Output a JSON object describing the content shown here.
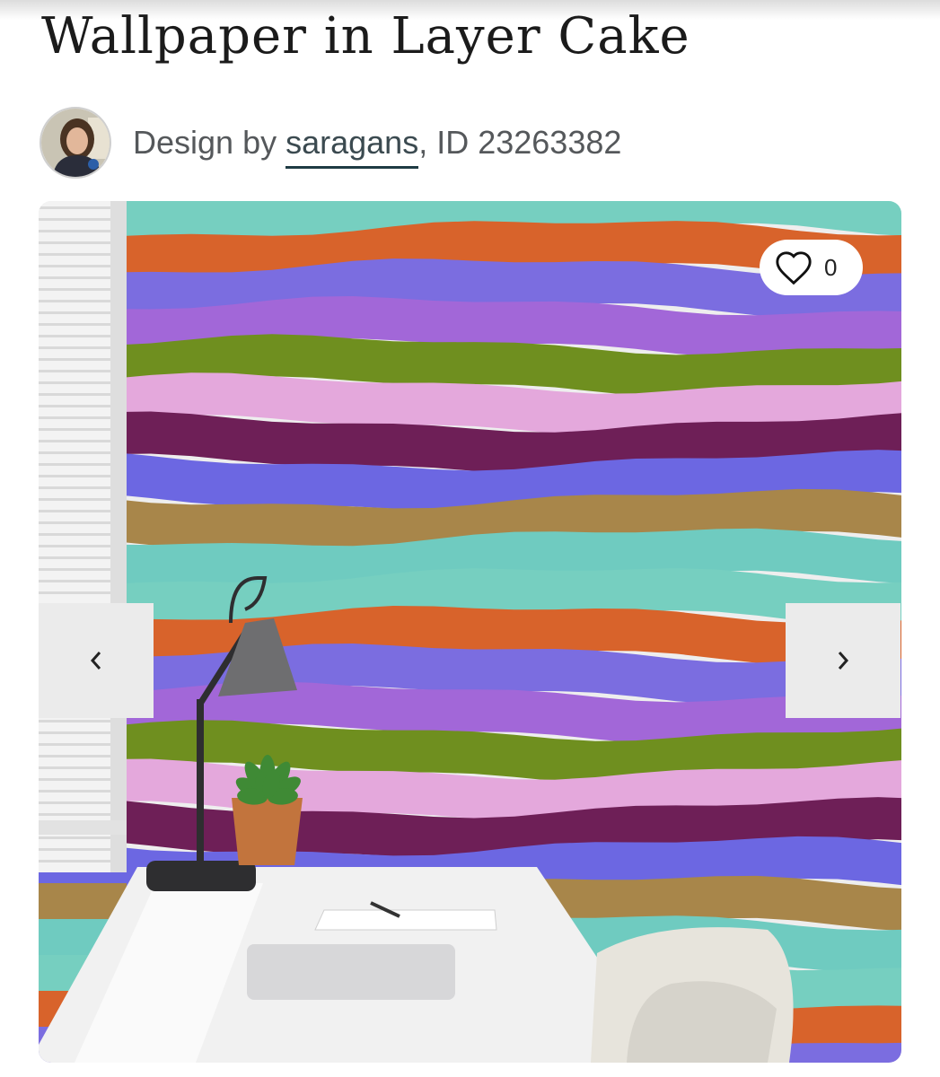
{
  "product": {
    "title": "Wallpaper in Layer Cake"
  },
  "byline": {
    "prefix": "Design by ",
    "designer": "saragans",
    "id_text": ", ID 23263382"
  },
  "hero": {
    "favorite_count": "0",
    "icons": {
      "favorite": "heart-outline-icon",
      "previous": "chevron-left-icon",
      "next": "chevron-right-icon"
    },
    "stripe_colors": [
      "#76cfc0",
      "#d8632b",
      "#7b6de0",
      "#a267d8",
      "#6f8f1f",
      "#e4a8dc",
      "#6e1f57",
      "#6c67e2",
      "#a8864a",
      "#6fcbc0"
    ]
  }
}
